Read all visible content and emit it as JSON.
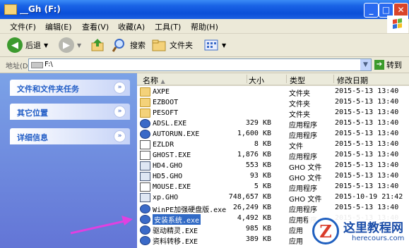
{
  "window": {
    "title": "__Gh (F:)",
    "min_icon": "minimize-icon",
    "max_icon": "maximize-icon",
    "close_icon": "close-icon"
  },
  "menu": [
    "文件(F)",
    "编辑(E)",
    "查看(V)",
    "收藏(A)",
    "工具(T)",
    "帮助(H)"
  ],
  "toolbar": {
    "back_label": "后退",
    "search_label": "搜索",
    "folders_label": "文件夹"
  },
  "address": {
    "label": "地址(D)",
    "value": "F:\\",
    "go_label": "转到"
  },
  "tasks": [
    {
      "label": "文件和文件夹任务"
    },
    {
      "label": "其它位置"
    },
    {
      "label": "详细信息"
    }
  ],
  "columns": {
    "name": "名称",
    "size": "大小",
    "type": "类型",
    "date": "修改日期"
  },
  "files": [
    {
      "name": "AXPE",
      "size": "",
      "type": "文件夹",
      "date": "2015-5-13 13:40",
      "icon": "folder"
    },
    {
      "name": "EZBOOT",
      "size": "",
      "type": "文件夹",
      "date": "2015-5-13 13:40",
      "icon": "folder"
    },
    {
      "name": "PESOFT",
      "size": "",
      "type": "文件夹",
      "date": "2015-5-13 13:40",
      "icon": "folder"
    },
    {
      "name": "ADSL.EXE",
      "size": "329 KB",
      "type": "应用程序",
      "date": "2015-5-13 13:40",
      "icon": "app"
    },
    {
      "name": "AUTORUN.EXE",
      "size": "1,600 KB",
      "type": "应用程序",
      "date": "2015-5-13 13:40",
      "icon": "app"
    },
    {
      "name": "EZLDR",
      "size": "8 KB",
      "type": "文件",
      "date": "2015-5-13 13:40",
      "icon": "file"
    },
    {
      "name": "GHOST.EXE",
      "size": "1,876 KB",
      "type": "应用程序",
      "date": "2015-5-13 13:40",
      "icon": "file"
    },
    {
      "name": "HD4.GHO",
      "size": "553 KB",
      "type": "GHO 文件",
      "date": "2015-5-13 13:40",
      "icon": "gho"
    },
    {
      "name": "HD5.GHO",
      "size": "93 KB",
      "type": "GHO 文件",
      "date": "2015-5-13 13:40",
      "icon": "gho"
    },
    {
      "name": "MOUSE.EXE",
      "size": "5 KB",
      "type": "应用程序",
      "date": "2015-5-13 13:40",
      "icon": "file"
    },
    {
      "name": "xp.GHO",
      "size": "748,657 KB",
      "type": "GHO 文件",
      "date": "2015-10-19 21:42",
      "icon": "gho"
    },
    {
      "name": "WinPE加强硬盘版.exe",
      "size": "26,249 KB",
      "type": "应用程序",
      "date": "2015-5-13 13:40",
      "icon": "app"
    },
    {
      "name": "安装系统.exe",
      "size": "4,492 KB",
      "type": "应用程序",
      "date": "2015-5-13 13:40",
      "icon": "app",
      "selected": true
    },
    {
      "name": "驱动精灵.EXE",
      "size": "985 KB",
      "type": "应用",
      "date": "",
      "icon": "app"
    },
    {
      "name": "资料转移.EXE",
      "size": "389 KB",
      "type": "应用",
      "date": "",
      "icon": "app"
    }
  ],
  "watermark": {
    "logo": "Z",
    "title": "这里教程网",
    "url": "herecours.com"
  },
  "colors": {
    "titlebar": "#0b4fd8",
    "taskpane": "#6f8fe0",
    "selection": "#316ac5",
    "arrow": "#e040e0"
  }
}
